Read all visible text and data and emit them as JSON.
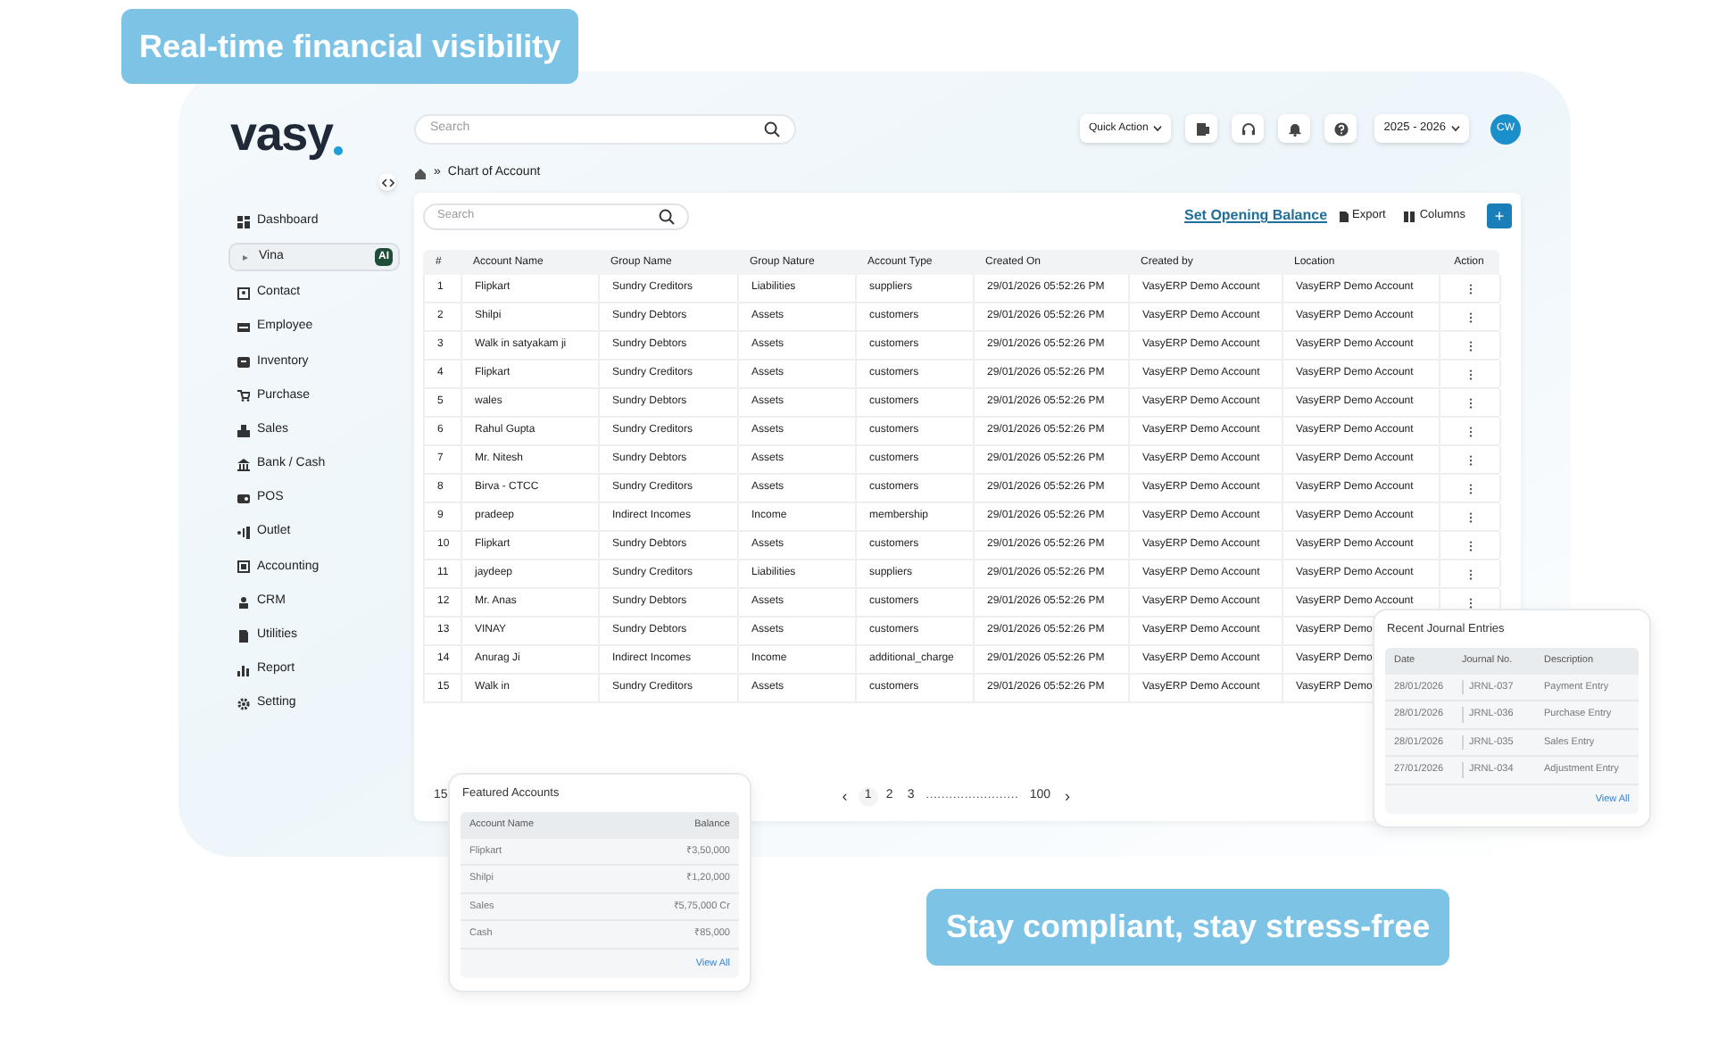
{
  "headline": "Real-time financial visibility",
  "tagline": "Stay compliant, stay stress-free",
  "app": {
    "logo": "vasy",
    "search": {
      "placeholder": "Search"
    },
    "quick_action": "Quick Action",
    "year": "2025 - 2026",
    "avatar": "CW",
    "sidebar": [
      {
        "label": "Dashboard",
        "selected": false
      },
      {
        "label": "Vina",
        "selected": true,
        "badge": "AI"
      },
      {
        "label": "Contact",
        "selected": false
      },
      {
        "label": "Employee",
        "selected": false
      },
      {
        "label": "Inventory",
        "selected": false
      },
      {
        "label": "Purchase",
        "selected": false
      },
      {
        "label": "Sales",
        "selected": false
      },
      {
        "label": "Bank / Cash",
        "selected": false
      },
      {
        "label": "POS",
        "selected": false
      },
      {
        "label": "Outlet",
        "selected": false
      },
      {
        "label": "Accounting",
        "selected": false
      },
      {
        "label": "CRM",
        "selected": false
      },
      {
        "label": "Utilities",
        "selected": false
      },
      {
        "label": "Report",
        "selected": false
      },
      {
        "label": "Setting",
        "selected": false
      }
    ],
    "breadcrumb": [
      "»",
      "Chart of Account"
    ],
    "table_search": {
      "placeholder": "Search"
    },
    "toolbar": {
      "link": "Set Opening Balance",
      "export": "Export",
      "columns": "Columns",
      "add": "+"
    },
    "table": {
      "columns": [
        "#",
        "Account Name",
        "Group Name",
        "Group Nature",
        "Account Type",
        "Created On",
        "Created by",
        "Location",
        "Action"
      ],
      "rows": [
        {
          "cells": [
            "1",
            "Flipkart",
            "Sundry Creditors",
            "Liabilities",
            "suppliers",
            "29/01/2026 05:52:26 PM",
            "VasyERP Demo Account",
            "VasyERP Demo Account"
          ],
          "menu": true
        },
        {
          "cells": [
            "2",
            "Shilpi",
            "Sundry Debtors",
            "Assets",
            "customers",
            "29/01/2026 05:52:26 PM",
            "VasyERP Demo Account",
            "VasyERP Demo Account"
          ],
          "menu": true
        },
        {
          "cells": [
            "3",
            "Walk in satyakam ji",
            "Sundry Debtors",
            "Assets",
            "customers",
            "29/01/2026 05:52:26 PM",
            "VasyERP Demo Account",
            "VasyERP Demo Account"
          ],
          "menu": true
        },
        {
          "cells": [
            "4",
            "Flipkart",
            "Sundry Creditors",
            "Assets",
            "customers",
            "29/01/2026 05:52:26 PM",
            "VasyERP Demo Account",
            "VasyERP Demo Account"
          ],
          "menu": true
        },
        {
          "cells": [
            "5",
            "wales",
            "Sundry Debtors",
            "Assets",
            "customers",
            "29/01/2026 05:52:26 PM",
            "VasyERP Demo Account",
            "VasyERP Demo Account"
          ],
          "menu": true
        },
        {
          "cells": [
            "6",
            "Rahul Gupta",
            "Sundry Creditors",
            "Assets",
            "customers",
            "29/01/2026 05:52:26 PM",
            "VasyERP Demo Account",
            "VasyERP Demo Account"
          ],
          "menu": true
        },
        {
          "cells": [
            "7",
            "Mr. Nitesh",
            "Sundry Debtors",
            "Assets",
            "customers",
            "29/01/2026 05:52:26 PM",
            "VasyERP Demo Account",
            "VasyERP Demo Account"
          ],
          "menu": true
        },
        {
          "cells": [
            "8",
            "Birva - CTCC",
            "Sundry Creditors",
            "Assets",
            "customers",
            "29/01/2026 05:52:26 PM",
            "VasyERP Demo Account",
            "VasyERP Demo Account"
          ],
          "menu": true
        },
        {
          "cells": [
            "9",
            "pradeep",
            "Indirect Incomes",
            "Income",
            "membership",
            "29/01/2026 05:52:26 PM",
            "VasyERP Demo Account",
            "VasyERP Demo Account"
          ],
          "menu": true
        },
        {
          "cells": [
            "10",
            "Flipkart",
            "Sundry Debtors",
            "Assets",
            "customers",
            "29/01/2026 05:52:26 PM",
            "VasyERP Demo Account",
            "VasyERP Demo Account"
          ],
          "menu": true
        },
        {
          "cells": [
            "11",
            "jaydeep",
            "Sundry Creditors",
            "Liabilities",
            "suppliers",
            "29/01/2026 05:52:26 PM",
            "VasyERP Demo Account",
            "VasyERP Demo Account"
          ],
          "menu": true
        },
        {
          "cells": [
            "12",
            "Mr. Anas",
            "Sundry Debtors",
            "Assets",
            "customers",
            "29/01/2026 05:52:26 PM",
            "VasyERP Demo Account",
            "VasyERP Demo Account"
          ],
          "menu": true
        },
        {
          "cells": [
            "13",
            "VINAY",
            "Sundry Debtors",
            "Assets",
            "customers",
            "29/01/2026 05:52:26 PM",
            "VasyERP Demo Account",
            "VasyERP Demo"
          ],
          "menu": false
        },
        {
          "cells": [
            "14",
            "Anurag Ji",
            "Indirect Incomes",
            "Income",
            "additional_charge",
            "29/01/2026 05:52:26 PM",
            "VasyERP Demo Account",
            "VasyERP Demo"
          ],
          "menu": false
        },
        {
          "cells": [
            "15",
            "Walk in",
            "Sundry Creditors",
            "Assets",
            "customers",
            "29/01/2026 05:52:26 PM",
            "VasyERP Demo Account",
            "VasyERP Demo"
          ],
          "menu": false
        }
      ]
    },
    "page_size": "15",
    "pagination": {
      "prev": "‹",
      "pages": [
        {
          "label": "1",
          "selected": true
        },
        {
          "label": "2",
          "selected": false
        },
        {
          "label": "3",
          "selected": false
        }
      ],
      "gap": "........................",
      "last": "100",
      "next": "›"
    }
  },
  "featured_accounts": {
    "title": "Featured Accounts",
    "columns": [
      "Account Name",
      "Balance"
    ],
    "rows": [
      [
        "Flipkart",
        "₹3,50,000"
      ],
      [
        "Shilpi",
        "₹1,20,000"
      ],
      [
        "Sales",
        "₹5,75,000 Cr"
      ],
      [
        "Cash",
        "₹85,000"
      ]
    ],
    "link": "View All"
  },
  "journal_entries": {
    "title": "Recent Journal Entries",
    "columns": [
      "Date",
      "Journal No.",
      "Description"
    ],
    "rows": [
      [
        "28/01/2026",
        "JRNL-037",
        "Payment Entry"
      ],
      [
        "28/01/2026",
        "JRNL-036",
        "Purchase Entry"
      ],
      [
        "28/01/2026",
        "JRNL-035",
        "Sales Entry"
      ],
      [
        "27/01/2026",
        "JRNL-034",
        "Adjustment Entry"
      ]
    ],
    "link": "View All"
  }
}
